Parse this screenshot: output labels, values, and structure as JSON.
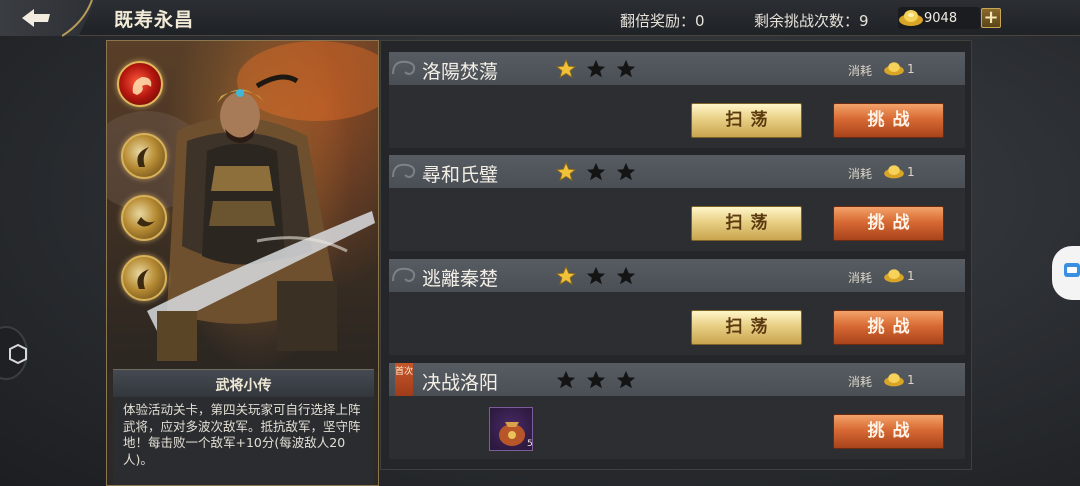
{
  "header": {
    "title": "既寿永昌",
    "double_reward_label": "翻倍奖励：",
    "double_reward_value": "0",
    "remaining_label": "剩余挑战次数：",
    "remaining_value": "9",
    "gold_amount": "9048",
    "plus_label": "+"
  },
  "hero": {
    "bio_title": "武将小传",
    "bio_text": "体验活动关卡，第四关玩家可自行选择上阵武将，应对多波次敌军。抵抗敌军，坚守阵地！每击败一个敌军+10分(每波敌人20人)。",
    "skills": [
      "dragon-skill-icon",
      "claw-skill-icon",
      "crescent-skill-icon",
      "claw-skill-icon"
    ]
  },
  "stages": [
    {
      "name": "洛陽焚蕩",
      "stars": [
        true,
        false,
        false
      ],
      "cost_label": "消耗",
      "cost_value": "1",
      "sweep_label": "扫荡",
      "fight_label": "挑战"
    },
    {
      "name": "尋和氏璧",
      "stars": [
        true,
        false,
        false
      ],
      "cost_label": "消耗",
      "cost_value": "1",
      "sweep_label": "扫荡",
      "fight_label": "挑战"
    },
    {
      "name": "逃離秦楚",
      "stars": [
        true,
        false,
        false
      ],
      "cost_label": "消耗",
      "cost_value": "1",
      "sweep_label": "扫荡",
      "fight_label": "挑战"
    },
    {
      "name": "决战洛阳",
      "stars": [
        false,
        false,
        false
      ],
      "first_badge": "首次",
      "cost_label": "消耗",
      "cost_value": "1",
      "reward_count": "5",
      "fight_label": "挑战"
    }
  ],
  "colors": {
    "star_filled": "#f2c13c",
    "star_empty": "#141414",
    "sweep_button": "#e8cf85",
    "fight_button": "#d86a34"
  }
}
